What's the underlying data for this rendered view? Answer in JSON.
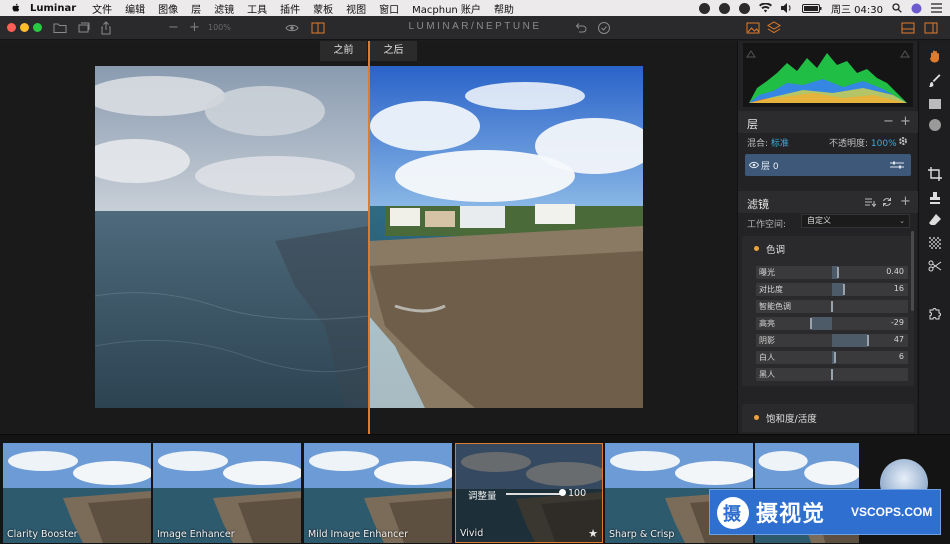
{
  "menubar": {
    "app_name": "Luminar",
    "items": [
      "文件",
      "编辑",
      "图像",
      "层",
      "滤镜",
      "工具",
      "插件",
      "蒙板",
      "视图",
      "窗口",
      "Macphun 账户",
      "帮助"
    ],
    "clock": "周三 04:30"
  },
  "toolbar": {
    "app_title": "LUMINAR/NEPTUNE",
    "zoom_minus": "−",
    "zoom_plus": "+",
    "zoom_value": "100%"
  },
  "canvas": {
    "before_label": "之前",
    "after_label": "之后"
  },
  "layers": {
    "title": "层",
    "blend_label": "混合:",
    "blend_value": "标准",
    "opacity_label": "不透明度:",
    "opacity_value": "100%",
    "layer_name": "层 0"
  },
  "filters": {
    "title": "滤镜",
    "workspace_label": "工作空间:",
    "workspace_value": "自定义",
    "tone": {
      "title": "色调",
      "sliders": [
        {
          "label": "曝光",
          "value": "0.40",
          "fraction": 0.54
        },
        {
          "label": "对比度",
          "value": "16",
          "fraction": 0.58
        },
        {
          "label": "智能色调",
          "value": "",
          "fraction": 0.5
        },
        {
          "label": "高亮",
          "value": "-29",
          "fraction": 0.36
        },
        {
          "label": "阴影",
          "value": "47",
          "fraction": 0.74
        },
        {
          "label": "白人",
          "value": "6",
          "fraction": 0.52
        },
        {
          "label": "黑人",
          "value": "",
          "fraction": 0.5
        }
      ]
    },
    "saturation": {
      "title": "饱和度/活度"
    }
  },
  "filmstrip": {
    "presets": [
      "Clarity Booster",
      "Image Enhancer",
      "Mild Image Enhancer",
      "Vivid",
      "Sharp & Crisp",
      ""
    ],
    "amount_label": "调整量",
    "amount_value": "100"
  },
  "watermark": {
    "cn": "摄视觉",
    "en": "VSCOPS.COM",
    "logo_char": "摄"
  },
  "colors": {
    "accent": "#e07b2b",
    "blend_blue": "#3fa9d6",
    "layer_selected": "#3d5878",
    "filter_dot": "#f0a33a"
  }
}
